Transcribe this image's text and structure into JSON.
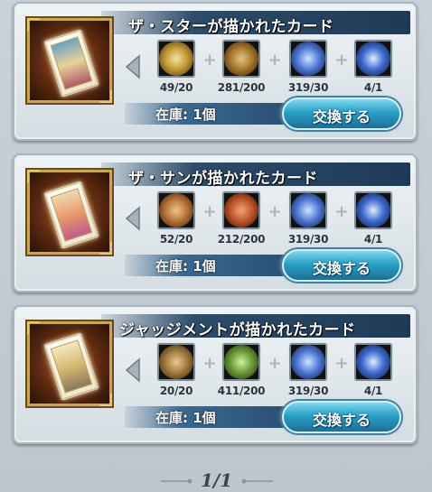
{
  "cards": [
    {
      "title": "ザ・スターが描かれたカード",
      "materials": [
        {
          "icon": "gold-medallion-icon",
          "count": "49/20",
          "color": "#c69a3a"
        },
        {
          "icon": "bronze-coin-icon",
          "count": "281/200",
          "color": "#a8782c"
        },
        {
          "icon": "blue-crystal-icon",
          "count": "319/30",
          "color": "#4f79d6"
        },
        {
          "icon": "blue-orb-icon",
          "count": "4/1",
          "color": "#3e6bd0"
        }
      ],
      "stock": "在庫: 1個",
      "button": "交換する"
    },
    {
      "title": "ザ・サンが描かれたカード",
      "materials": [
        {
          "icon": "sun-emblem-icon",
          "count": "52/20",
          "color": "#b8753a"
        },
        {
          "icon": "red-medallion-icon",
          "count": "212/200",
          "color": "#c0562c"
        },
        {
          "icon": "blue-crystal-icon",
          "count": "319/30",
          "color": "#4f79d6"
        },
        {
          "icon": "blue-orb-icon",
          "count": "4/1",
          "color": "#3e6bd0"
        }
      ],
      "stock": "在庫: 1個",
      "button": "交換する"
    },
    {
      "title": "ジャッジメントが描かれたカード",
      "materials": [
        {
          "icon": "bronze-emblem-icon",
          "count": "20/20",
          "color": "#a37a3e"
        },
        {
          "icon": "green-medallion-icon",
          "count": "411/200",
          "color": "#6b9a3a"
        },
        {
          "icon": "blue-crystal-icon",
          "count": "319/30",
          "color": "#4f79d6"
        },
        {
          "icon": "blue-orb-icon",
          "count": "4/1",
          "color": "#3e6bd0"
        }
      ],
      "stock": "在庫: 1個",
      "button": "交換する"
    }
  ],
  "pagination": {
    "label": "1/1"
  }
}
